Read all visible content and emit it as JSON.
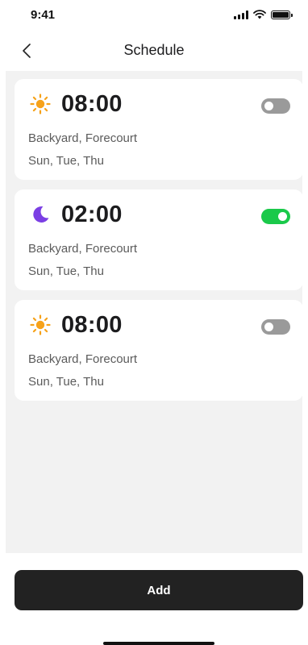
{
  "status_bar": {
    "time": "9:41"
  },
  "nav": {
    "title": "Schedule"
  },
  "schedules": [
    {
      "icon": "sun-icon",
      "time": "08:00",
      "enabled": false,
      "locations": "Backyard, Forecourt",
      "days": "Sun, Tue, Thu"
    },
    {
      "icon": "moon-icon",
      "time": "02:00",
      "enabled": true,
      "locations": "Backyard, Forecourt",
      "days": "Sun, Tue, Thu"
    },
    {
      "icon": "sun-icon",
      "time": "08:00",
      "enabled": false,
      "locations": "Backyard, Forecourt",
      "days": "Sun, Tue, Thu"
    }
  ],
  "colors": {
    "sun": "#f6a21a",
    "moon": "#7b3fe4",
    "toggle_on": "#1ac94a",
    "toggle_off": "#9a9a9a",
    "add_button": "#222222"
  },
  "add_button": {
    "label": "Add"
  }
}
